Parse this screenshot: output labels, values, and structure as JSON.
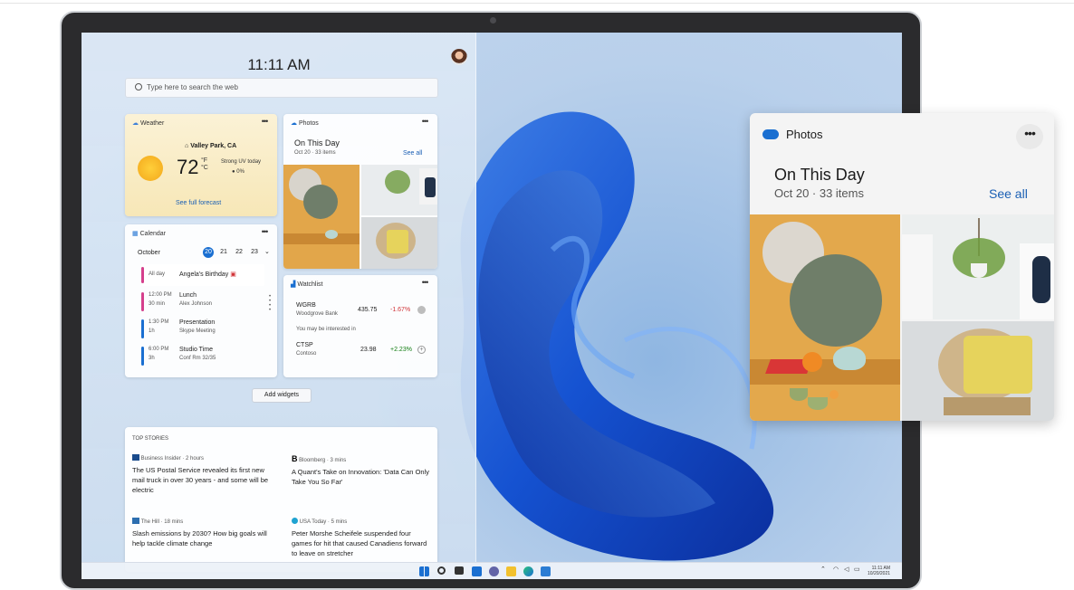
{
  "desktop": {
    "clock": "11:11 AM",
    "search_placeholder": "Type here to search the web",
    "add_widgets": "Add widgets"
  },
  "weather": {
    "title": "Weather",
    "location": "Valley Park, CA",
    "temp": "72",
    "unit_f": "°F",
    "unit_c": "°C",
    "uv": "Strong UV today",
    "rain": "0%",
    "link": "See full forecast"
  },
  "photos_small": {
    "title": "Photos",
    "heading": "On This Day",
    "sub": "Oct 20 · 33 items",
    "link": "See all"
  },
  "calendar": {
    "title": "Calendar",
    "month": "October",
    "days": [
      "20",
      "21",
      "22",
      "23"
    ],
    "events": [
      {
        "time": "All day",
        "duration": "",
        "title": "Angela's Birthday",
        "sub": "",
        "color": "#d53f8c"
      },
      {
        "time": "12:00 PM",
        "duration": "30 min",
        "title": "Lunch",
        "sub": "Alex Johnson",
        "color": "#d53f8c"
      },
      {
        "time": "1:30 PM",
        "duration": "1h",
        "title": "Presentation",
        "sub": "Skype Meeting",
        "color": "#1a6fd1"
      },
      {
        "time": "6:00 PM",
        "duration": "3h",
        "title": "Studio Time",
        "sub": "Conf Rm 32/35",
        "color": "#1a6fd1"
      }
    ]
  },
  "watchlist": {
    "title": "Watchlist",
    "stocks": [
      {
        "symbol": "WGRB",
        "name": "Woodgrove Bank",
        "price": "435.75",
        "change": "-1.67%",
        "color": "#d13438"
      },
      {
        "symbol": "CTSP",
        "name": "Contoso",
        "price": "23.98",
        "change": "+2.23%",
        "color": "#107c10"
      }
    ],
    "note": "You may be interested in"
  },
  "news": {
    "header": "TOP STORIES",
    "stories": [
      {
        "source": "Business Insider · 2 hours",
        "headline": "The US Postal Service revealed its first new mail truck in over 30 years - and some will be electric"
      },
      {
        "source": "Bloomberg · 3 mins",
        "headline": "A Quant's Take on Innovation: 'Data Can Only Take You So Far'"
      },
      {
        "source": "The Hill · 18 mins",
        "headline": "Slash emissions by 2030? How big goals will help tackle climate change"
      },
      {
        "source": "USA Today · 5 mins",
        "headline": "Peter Morshe Scheifele suspended four games for hit that caused Canadiens forward to leave on stretcher"
      }
    ]
  },
  "tray": {
    "time": "11:11 AM",
    "date": "10/20/2021"
  },
  "photos_big": {
    "title": "Photos",
    "heading": "On This Day",
    "sub": "Oct 20 · 33 items",
    "link": "See all"
  }
}
